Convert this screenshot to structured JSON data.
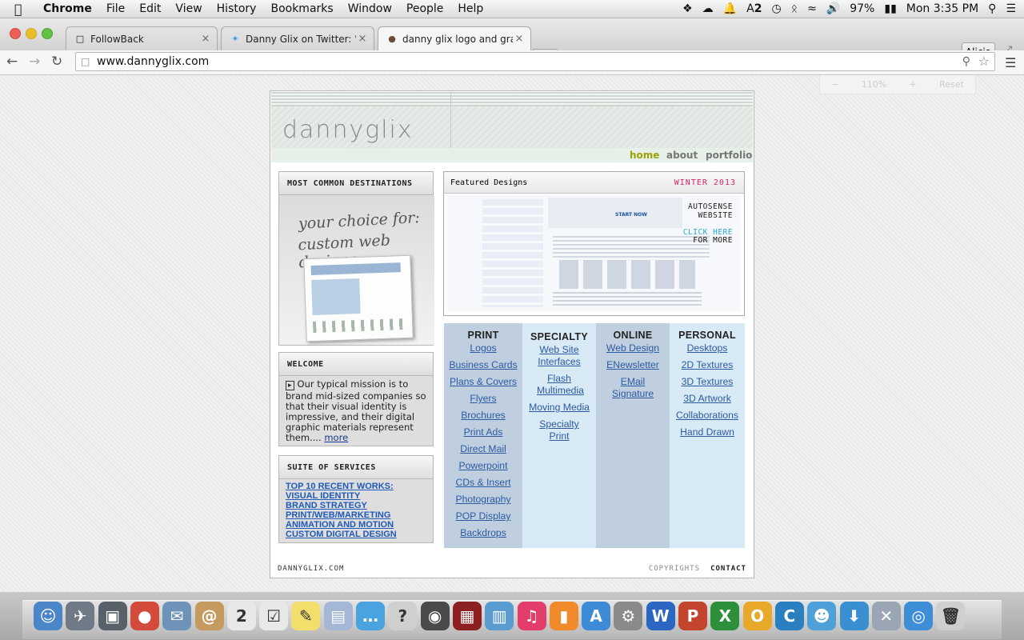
{
  "menubar": {
    "app": "Chrome",
    "items": [
      "File",
      "Edit",
      "View",
      "History",
      "Bookmarks",
      "Window",
      "People",
      "Help"
    ],
    "status": {
      "notif": "2",
      "battery": "97%",
      "clock": "Mon 3:35 PM"
    }
  },
  "tabs": [
    {
      "title": "FollowBack",
      "icon": "page-icon"
    },
    {
      "title": "Danny Glix on Twitter: \"$ra",
      "icon": "twitter-icon"
    },
    {
      "title": "danny glix logo and graph",
      "icon": "avatar-icon"
    }
  ],
  "user": "Alicia",
  "address": {
    "url": "www.dannyglix.com"
  },
  "zoom_popup": {
    "minus": "−",
    "level": "110%",
    "plus": "+",
    "reset": "Reset"
  },
  "site": {
    "logo": "dannyglix",
    "nav": [
      "home",
      "about",
      "portfolio"
    ],
    "boxes": {
      "destinations": "MOST COMMON DESTINATIONS",
      "promo_line1": "your choice for:",
      "promo_line2": "custom web designs",
      "welcome_title": "WELCOME",
      "welcome_text": "Our typical mission is to brand mid-sized companies so that their visual identity is impressive, and their digital graphic materials represent them....",
      "welcome_more": "more",
      "services_title": "SUITE OF SERVICES",
      "services": [
        "TOP 10 RECENT WORKS:",
        "VISUAL IDENTITY",
        "BRAND STRATEGY",
        "PRINT/WEB/MARKETING",
        "ANIMATION AND MOTION",
        "CUSTOM DIGITAL DESIGN"
      ]
    },
    "featured": {
      "title": "Featured Designs",
      "season": "WINTER 2013",
      "project_line1": "AUTOSENSE",
      "project_line2": "WEBSITE",
      "click_line1": "CLICK HERE",
      "click_line2": "FOR MORE",
      "start_now": "START NOW"
    },
    "categories": [
      {
        "title": "PRINT",
        "links": [
          "Logos",
          "Business Cards",
          "Plans & Covers",
          "Flyers",
          "Brochures",
          "Print Ads",
          "Direct Mail",
          "Powerpoint",
          "CDs & Insert",
          "Photography",
          "POP Display",
          "Backdrops"
        ]
      },
      {
        "title": "SPECIALTY",
        "links": [
          "Web Site Interfaces",
          "Flash Multimedia",
          "Moving Media",
          "Specialty Print"
        ]
      },
      {
        "title": "ONLINE",
        "links": [
          "Web Design",
          "ENewsletter",
          "EMail Signature"
        ]
      },
      {
        "title": "PERSONAL",
        "links": [
          "Desktops",
          "2D Textures",
          "3D Textures",
          "3D Artwork",
          "Collaborations",
          "Hand Drawn"
        ]
      }
    ],
    "footer": {
      "left": "DANNYGLIX.COM",
      "copyrights": "COPYRIGHTS",
      "contact": "CONTACT"
    }
  },
  "dock": [
    "finder-icon",
    "launchpad-icon",
    "photo-booth-icon",
    "chrome-icon",
    "mail-icon",
    "contacts-icon",
    "calendar-icon",
    "reminders-icon",
    "notes-icon",
    "preview-icon",
    "messages-icon",
    "help-icon",
    "facetime-icon",
    "photo-app-icon",
    "iphoto-icon",
    "itunes-icon",
    "ibooks-icon",
    "app-store-icon",
    "system-preferences-icon",
    "word-icon",
    "powerpoint-icon",
    "excel-icon",
    "outlook-icon",
    "communicator-icon",
    "messenger-icon",
    "download-icon",
    "xcode-icon",
    "safari-icon",
    "trash-icon"
  ],
  "colors": {
    "nav_active": "#9aa300",
    "nav": "#777777",
    "season": "#d6246a",
    "click": "#2aa7d9",
    "link": "#2b5aa0"
  }
}
